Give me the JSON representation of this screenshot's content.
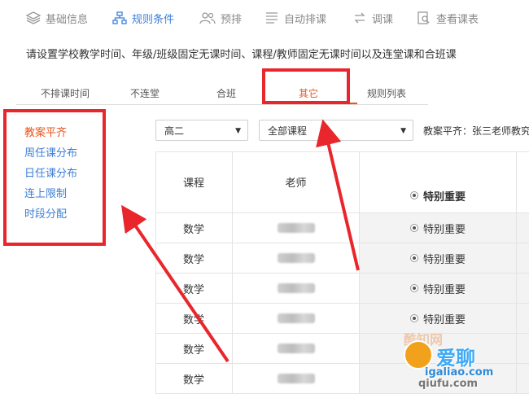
{
  "nav": {
    "items": [
      {
        "label": "基础信息",
        "icon": "layers-icon"
      },
      {
        "label": "规则条件",
        "icon": "network-icon"
      },
      {
        "label": "预排",
        "icon": "users-icon"
      },
      {
        "label": "自动排课",
        "icon": "list-icon"
      },
      {
        "label": "调课",
        "icon": "swap-icon"
      },
      {
        "label": "查看课表",
        "icon": "search-doc-icon"
      }
    ],
    "active_index": 1
  },
  "description": "请设置学校教学时间、年级/班级固定无课时间、课程/教师固定无课时间以及连堂课和合班课",
  "subtabs": [
    "不排课时间",
    "不连堂",
    "合班",
    "其它",
    "规则列表"
  ],
  "active_subtab": "其它",
  "left_menu": [
    "教案平齐",
    "周任课分布",
    "日任课分布",
    "连上限制",
    "时段分配"
  ],
  "active_left_menu": "教案平齐",
  "filters": {
    "grade": "高二",
    "course": "全部课程"
  },
  "note": "教案平齐：张三老师教究",
  "table": {
    "headers": {
      "course": "课程",
      "teacher": "老师",
      "priority": "特别重要"
    },
    "rows": [
      {
        "course": "数学",
        "priority": "特别重要"
      },
      {
        "course": "数学",
        "priority": "特别重要"
      },
      {
        "course": "数学",
        "priority": "特别重要"
      },
      {
        "course": "数学",
        "priority": "特别重要"
      },
      {
        "course": "数学",
        "priority": ""
      },
      {
        "course": "数学",
        "priority": ""
      }
    ]
  },
  "watermark": {
    "cn": "爱聊",
    "url1": "igaliao.com",
    "url2": "qiufu.com",
    "small": "酷知网"
  },
  "colors": {
    "accent": "#3b7fd6",
    "active": "#e8551f",
    "annotation": "#e8262b"
  }
}
